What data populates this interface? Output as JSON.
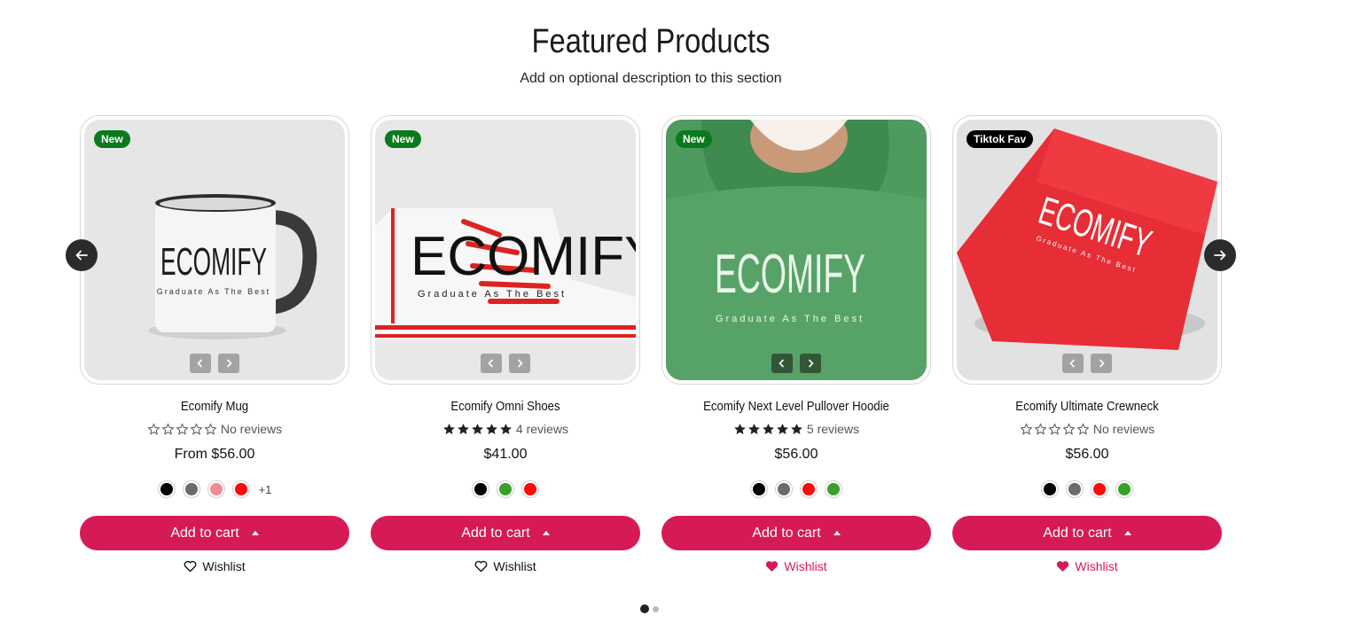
{
  "section": {
    "title": "Featured Products",
    "description": "Add on optional description to this section"
  },
  "products": [
    {
      "name": "Ecomify Mug",
      "badge": "New",
      "badge_color": "#0b7a1e",
      "rating": 0,
      "reviews": "No reviews",
      "price": "From $56.00",
      "swatches": [
        "#000000",
        "#6b6b6b",
        "#f08a93",
        "#ff0a0a"
      ],
      "more": "+1",
      "add_to_cart": "Add to cart",
      "wishlist": "Wishlist",
      "wishlisted": false,
      "image_theme": "mug"
    },
    {
      "name": "Ecomify Omni Shoes",
      "badge": "New",
      "badge_color": "#0b7a1e",
      "rating": 5,
      "reviews": "4 reviews",
      "price": "$41.00",
      "swatches": [
        "#000000",
        "#3aa02b",
        "#ff0a0a"
      ],
      "more": "",
      "add_to_cart": "Add to cart",
      "wishlist": "Wishlist",
      "wishlisted": false,
      "image_theme": "shoe"
    },
    {
      "name": "Ecomify Next Level Pullover Hoodie",
      "badge": "New",
      "badge_color": "#0b7a1e",
      "rating": 5,
      "reviews": "5 reviews",
      "price": "$56.00",
      "swatches": [
        "#000000",
        "#6b6b6b",
        "#ff0a0a",
        "#3aa02b"
      ],
      "more": "",
      "add_to_cart": "Add to cart",
      "wishlist": "Wishlist",
      "wishlisted": true,
      "image_theme": "hoodie"
    },
    {
      "name": "Ecomify Ultimate Crewneck",
      "badge": "Tiktok Fav",
      "badge_color": "#000000",
      "rating": 0,
      "reviews": "No reviews",
      "price": "$56.00",
      "swatches": [
        "#000000",
        "#6b6b6b",
        "#ff0a0a",
        "#3aa02b"
      ],
      "more": "",
      "add_to_cart": "Add to cart",
      "wishlist": "Wishlist",
      "wishlisted": true,
      "image_theme": "crewneck"
    }
  ],
  "product_image_text": {
    "brand": "ECOMIFY",
    "tagline": "Graduate As The Best"
  },
  "colors": {
    "accent": "#d61a55",
    "arrow_bg": "#2b2b2b",
    "star": "#222222"
  },
  "carousel": {
    "prev_icon": "arrow-left-icon",
    "next_icon": "arrow-right-icon",
    "pages": 2,
    "active_page": 1
  }
}
